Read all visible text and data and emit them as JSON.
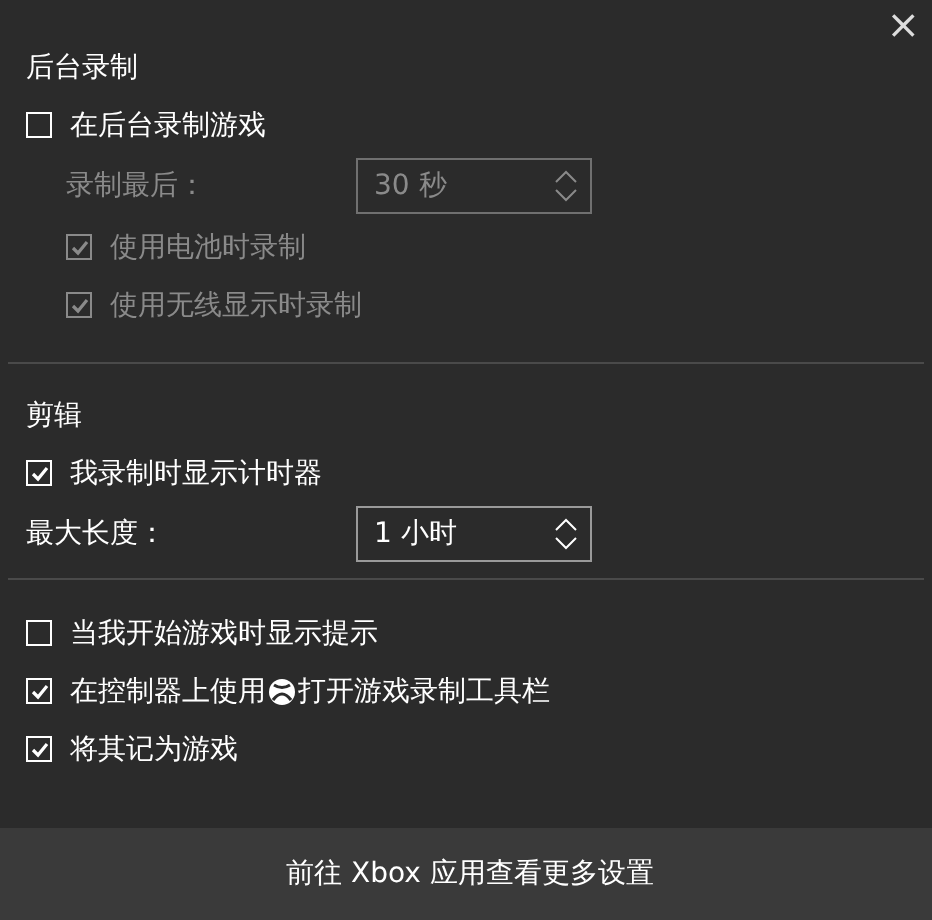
{
  "close_icon": "×",
  "sections": [
    {
      "title": "后台录制",
      "items": [
        {
          "kind": "checkbox",
          "label": "在后台录制游戏",
          "checked": false,
          "disabled": false,
          "children": [
            {
              "kind": "spinner",
              "label": "录制最后：",
              "value": "30 秒",
              "disabled": true
            },
            {
              "kind": "checkbox",
              "label": "使用电池时录制",
              "checked": true,
              "disabled": true
            },
            {
              "kind": "checkbox",
              "label": "使用无线显示时录制",
              "checked": true,
              "disabled": true
            }
          ]
        }
      ]
    },
    {
      "title": "剪辑",
      "items": [
        {
          "kind": "checkbox",
          "label": "我录制时显示计时器",
          "checked": true,
          "disabled": false
        },
        {
          "kind": "spinner",
          "label": "最大长度：",
          "value": "1 小时",
          "disabled": false
        }
      ]
    },
    {
      "items": [
        {
          "kind": "checkbox",
          "label": "当我开始游戏时显示提示",
          "checked": false,
          "disabled": false
        },
        {
          "kind": "checkbox",
          "label": "在控制器上使用",
          "label_after": "打开游戏录制工具栏",
          "checked": true,
          "disabled": false
        },
        {
          "kind": "checkbox",
          "label": "将其记为游戏",
          "checked": true,
          "disabled": false
        }
      ]
    }
  ],
  "footer_link": "前往 Xbox 应用查看更多设置"
}
